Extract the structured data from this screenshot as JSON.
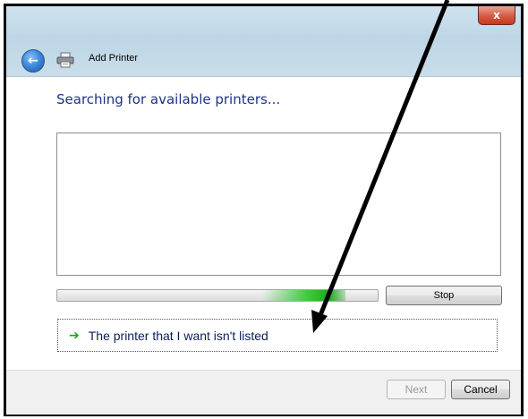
{
  "window": {
    "title": "Add Printer",
    "close_label": "x"
  },
  "main": {
    "heading": "Searching for available printers...",
    "progress": 0.9,
    "stop_label": "Stop",
    "not_listed_link": "The printer that I want isn't listed"
  },
  "footer": {
    "next_label": "Next",
    "cancel_label": "Cancel"
  },
  "icons": {
    "back": "back-arrow-icon",
    "printer": "printer-icon",
    "link_arrow": "green-arrow-icon"
  },
  "colors": {
    "heading": "#1e3287",
    "progress": "#3ec83e",
    "annotation_arrow": "#000000"
  }
}
